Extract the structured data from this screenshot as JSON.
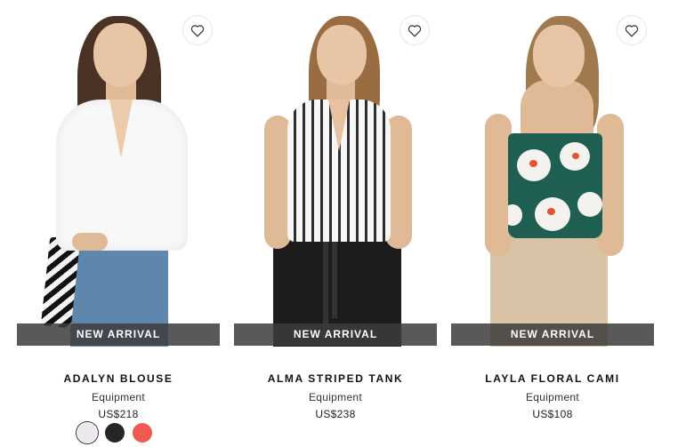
{
  "products": [
    {
      "name": "ADALYN BLOUSE",
      "brand": "Equipment",
      "price": "US$218",
      "badge": "NEW ARRIVAL",
      "swatches": [
        {
          "color": "#ece8ee",
          "selected": true
        },
        {
          "color": "#262626",
          "selected": false
        },
        {
          "color": "#f05a50",
          "selected": false
        }
      ]
    },
    {
      "name": "ALMA STRIPED TANK",
      "brand": "Equipment",
      "price": "US$238",
      "badge": "NEW ARRIVAL"
    },
    {
      "name": "LAYLA FLORAL CAMI",
      "brand": "Equipment",
      "price": "US$108",
      "badge": "NEW ARRIVAL"
    }
  ]
}
